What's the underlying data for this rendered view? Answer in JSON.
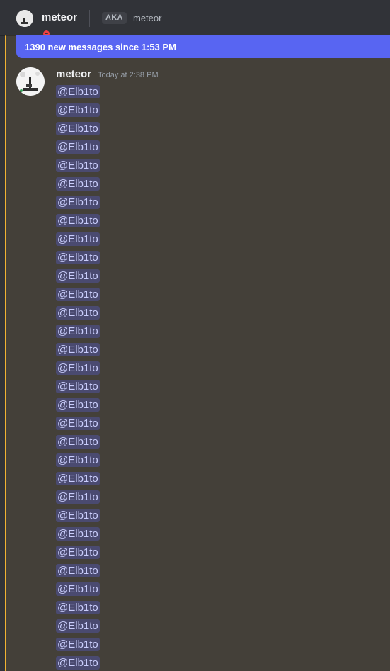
{
  "header": {
    "dm_name": "meteor",
    "aka_label": "AKA",
    "aka_name": "meteor",
    "status": "do-not-disturb",
    "status_color": "#f23f43"
  },
  "banner": {
    "text": "1390 new messages since 1:53 PM",
    "color": "#5865f2"
  },
  "message": {
    "author": "meteor",
    "timestamp": "Today at 2:38 PM",
    "highlight_color": "#f0b232",
    "mention_color": "#c9cdfb",
    "mentions": [
      "@Elb1to",
      "@Elb1to",
      "@Elb1to",
      "@Elb1to",
      "@Elb1to",
      "@Elb1to",
      "@Elb1to",
      "@Elb1to",
      "@Elb1to",
      "@Elb1to",
      "@Elb1to",
      "@Elb1to",
      "@Elb1to",
      "@Elb1to",
      "@Elb1to",
      "@Elb1to",
      "@Elb1to",
      "@Elb1to",
      "@Elb1to",
      "@Elb1to",
      "@Elb1to",
      "@Elb1to",
      "@Elb1to",
      "@Elb1to",
      "@Elb1to",
      "@Elb1to",
      "@Elb1to",
      "@Elb1to",
      "@Elb1to",
      "@Elb1to",
      "@Elb1to",
      "@Elb1to"
    ]
  }
}
